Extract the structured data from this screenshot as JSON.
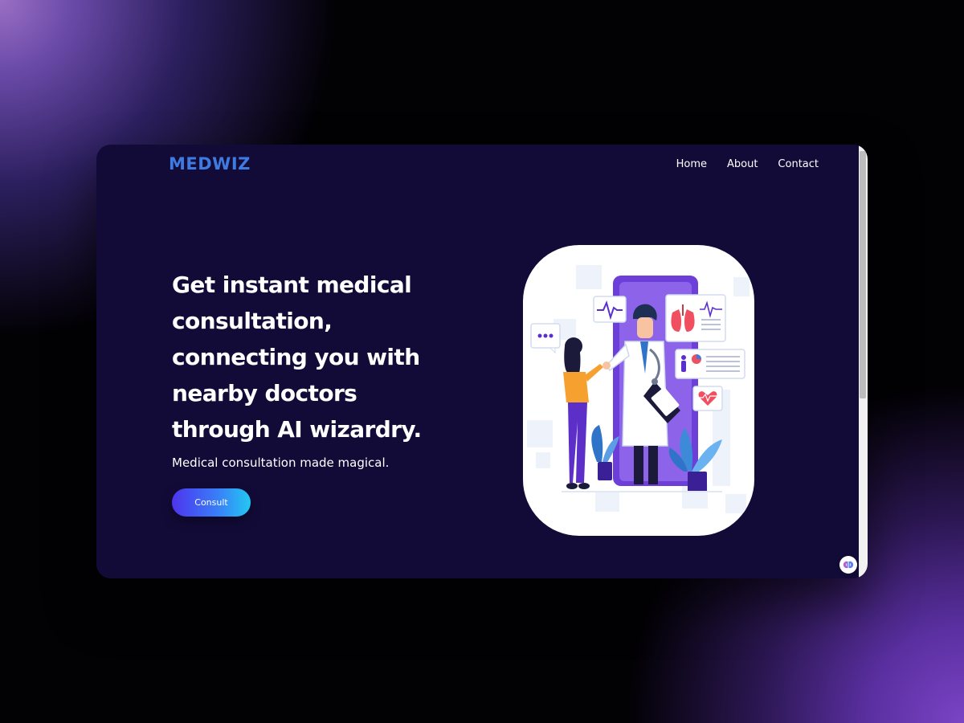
{
  "app": {
    "logo_text": "MEDWIZ"
  },
  "nav": {
    "items": [
      "Home",
      "About",
      "Contact"
    ]
  },
  "hero": {
    "headline": "Get instant medical consultation, connecting you with nearby doctors through AI wizardry.",
    "subline": "Medical consultation made magical.",
    "cta_label": "Consult"
  },
  "illustration": {
    "subject": "doctor-and-patient-telemedicine"
  },
  "colors": {
    "window_bg": "#120b38",
    "logo": "#3f7ae0",
    "accent_gradient_start": "#4d34ee",
    "accent_gradient_end": "#23c8f2",
    "phone_purple": "#6b3fd8"
  },
  "icons": {
    "assistant": "brain-icon"
  }
}
